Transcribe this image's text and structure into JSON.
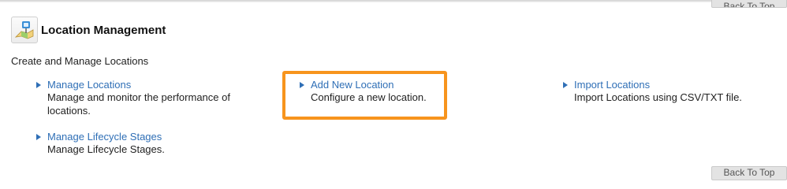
{
  "back_to_top": {
    "label": "Back To Top"
  },
  "section": {
    "title": "Location Management",
    "description": "Create and Manage Locations",
    "icon": "map-location-icon"
  },
  "items": [
    {
      "label": "Manage Locations",
      "description": "Manage and monitor the performance of locations."
    },
    {
      "label": "Manage Lifecycle Stages",
      "description": "Manage Lifecycle Stages."
    },
    {
      "label": "Add New Location",
      "description": "Configure a new location."
    },
    {
      "label": "Import Locations",
      "description": "Import Locations using CSV/TXT file."
    }
  ],
  "colors": {
    "link": "#2f6fb6",
    "highlight": "#f7941d"
  }
}
